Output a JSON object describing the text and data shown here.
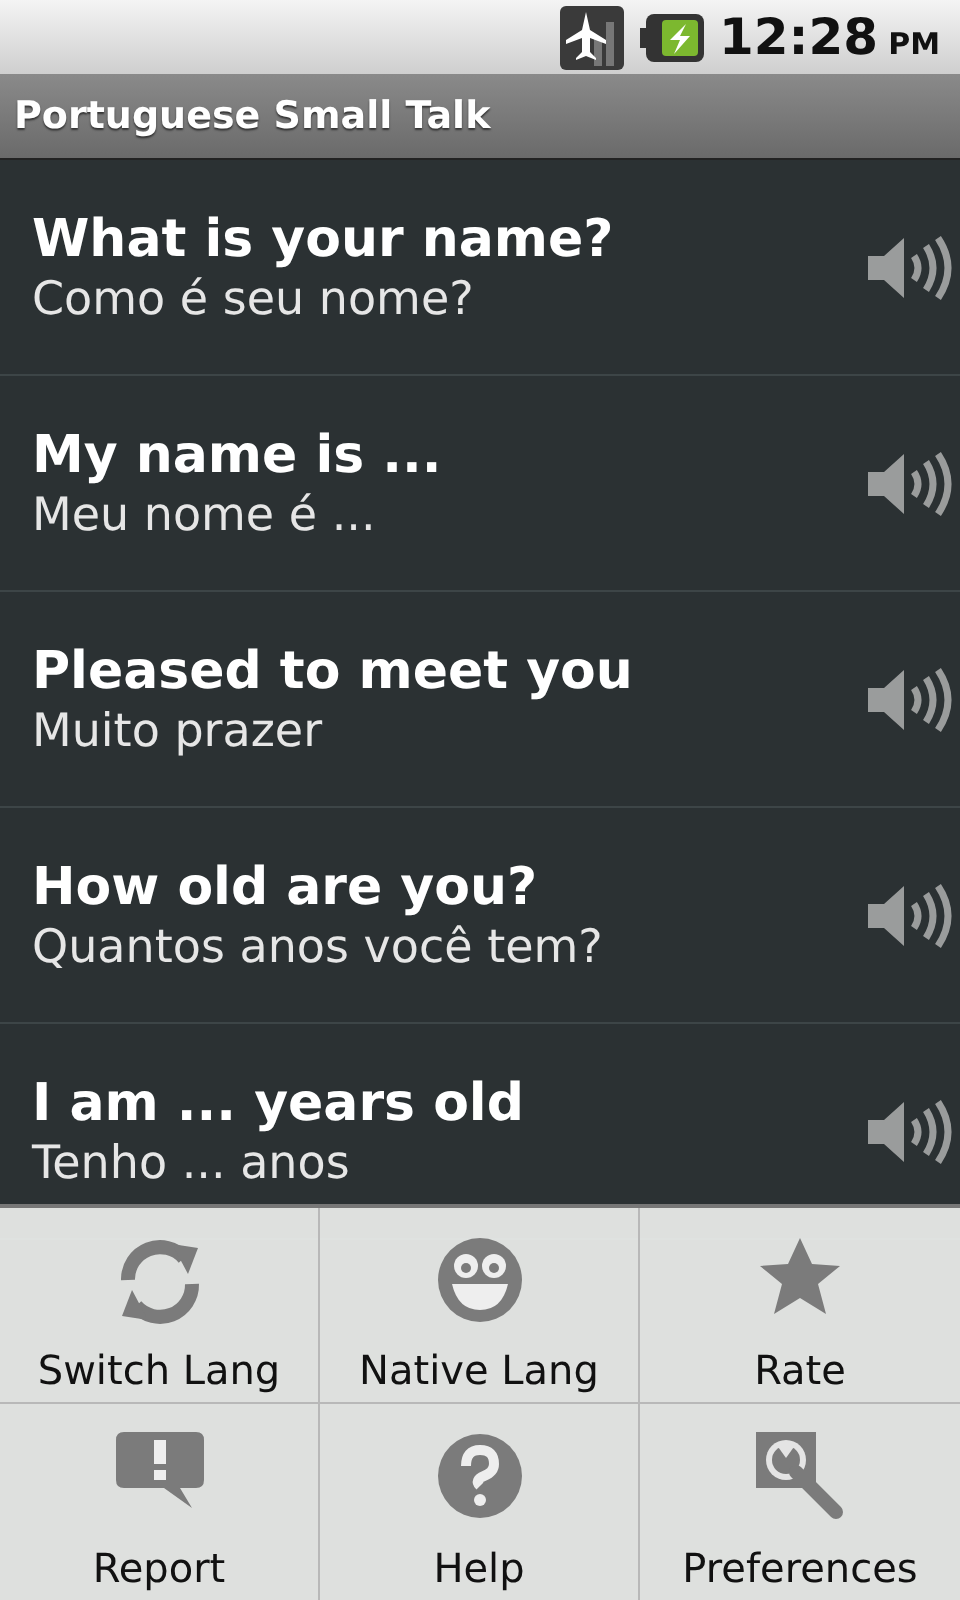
{
  "status_bar": {
    "time": "12:28",
    "meridiem": "PM"
  },
  "title_bar": {
    "title": "Portuguese Small Talk"
  },
  "phrases": [
    {
      "english": "What is your name?",
      "portuguese": "Como é seu nome?"
    },
    {
      "english": "My name is ...",
      "portuguese": "Meu nome é ..."
    },
    {
      "english": "Pleased to meet you",
      "portuguese": "Muito prazer"
    },
    {
      "english": "How old are you?",
      "portuguese": "Quantos anos você tem?"
    },
    {
      "english": "I am ... years old",
      "portuguese": "Tenho ... anos"
    }
  ],
  "options_menu": [
    {
      "label": "Switch Lang",
      "kind": "refresh"
    },
    {
      "label": "Native Lang",
      "kind": "smiley"
    },
    {
      "label": "Rate",
      "kind": "star"
    },
    {
      "label": "Report",
      "kind": "alert"
    },
    {
      "label": "Help",
      "kind": "help"
    },
    {
      "label": "Preferences",
      "kind": "wrench"
    }
  ]
}
